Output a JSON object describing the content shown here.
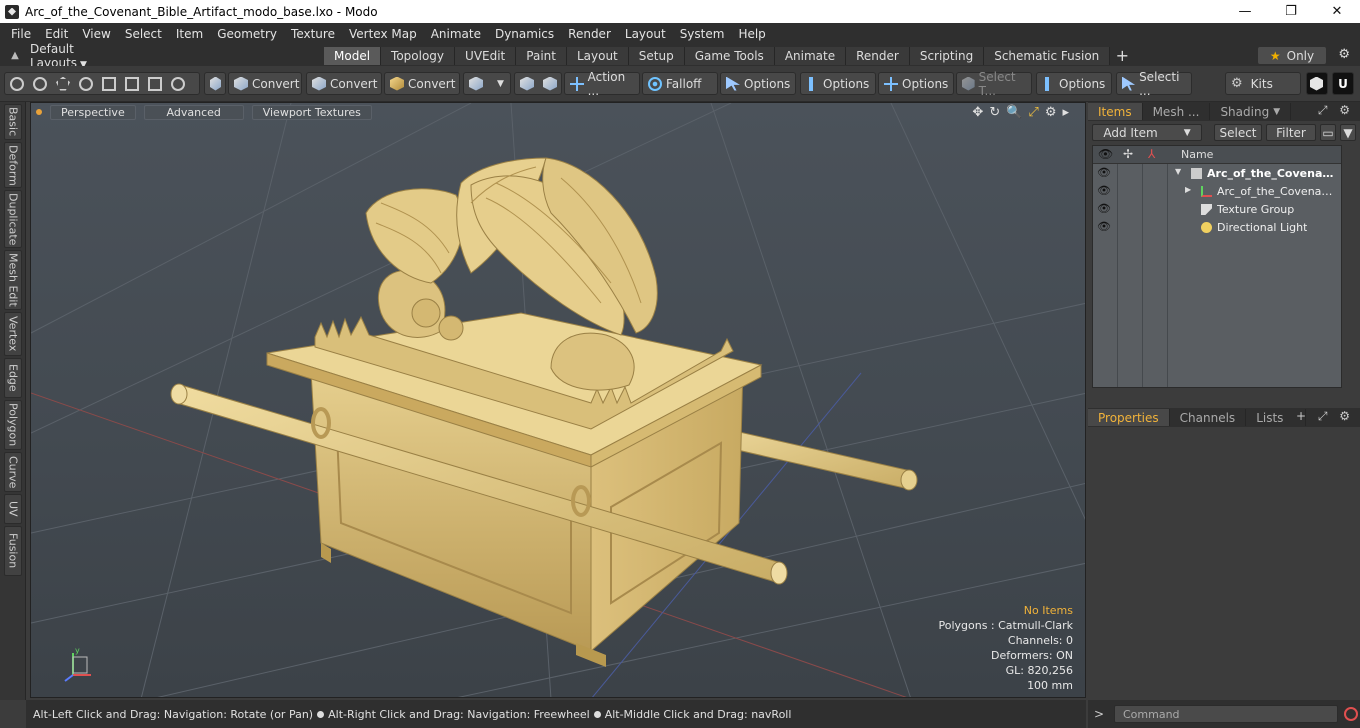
{
  "window": {
    "title": "Arc_of_the_Covenant_Bible_Artifact_modo_base.lxo - Modo",
    "controls": [
      "—",
      "❐",
      "✕"
    ]
  },
  "menu": [
    "File",
    "Edit",
    "View",
    "Select",
    "Item",
    "Geometry",
    "Texture",
    "Vertex Map",
    "Animate",
    "Dynamics",
    "Render",
    "Layout",
    "System",
    "Help"
  ],
  "layouts": {
    "selector": "Default Layouts",
    "tabs": [
      "Model",
      "Topology",
      "UVEdit",
      "Paint",
      "Layout",
      "Setup",
      "Game Tools",
      "Animate",
      "Render",
      "Scripting",
      "Schematic Fusion"
    ],
    "active": "Model",
    "only_label": "Only"
  },
  "toolbar": {
    "convert1": "Convert",
    "convert2": "Convert",
    "convert3": "Convert",
    "action": "Action ...",
    "falloff": "Falloff",
    "options1": "Options",
    "options2": "Options",
    "options3": "Options",
    "select_t": "Select T...",
    "options4": "Options",
    "selecti": "Selecti ...",
    "kits": "Kits"
  },
  "left_tabs": [
    "Basic",
    "Deform",
    "Duplicate",
    "Mesh Edit",
    "Vertex",
    "Edge",
    "Polygon",
    "Curve",
    "UV",
    "Fusion"
  ],
  "viewport": {
    "perspective": "Perspective",
    "advanced": "Advanced",
    "textures": "Viewport Textures",
    "nav_icons": [
      "✥",
      "↻",
      "🔍",
      "⤢",
      "⚙",
      "▸"
    ],
    "stats": {
      "no_items": "No Items",
      "polygons": "Polygons : Catmull-Clark",
      "channels": "Channels: 0",
      "deformers": "Deformers: ON",
      "gl": "GL: 820,256",
      "scale": "100 mm"
    },
    "axis": {
      "x": "x",
      "y": "y",
      "z": "z"
    }
  },
  "status": {
    "part1": "Alt-Left Click and Drag: Navigation: Rotate (or Pan)",
    "part2": "Alt-Right Click and Drag: Navigation: Freewheel",
    "part3": "Alt-Middle Click and Drag: navRoll"
  },
  "items_panel": {
    "tabs": [
      "Items",
      "Mesh ...",
      "Shading"
    ],
    "add_item": "Add Item",
    "select": "Select",
    "filter": "Filter",
    "name_header": "Name",
    "rows": [
      {
        "label": "Arc_of_the_Covenan...",
        "bold": true
      },
      {
        "label": "Arc_of_the_Covenant...",
        "bold": false
      },
      {
        "label": "Texture Group",
        "bold": false
      },
      {
        "label": "Directional Light",
        "bold": false
      }
    ]
  },
  "properties_panel": {
    "tabs": [
      "Properties",
      "Channels",
      "Lists"
    ]
  },
  "command": {
    "placeholder": "Command",
    "prompt": ">"
  },
  "colors": {
    "accent": "#f0b23a",
    "artifact": "#d9c07a",
    "viewport_bg": "#474e55"
  }
}
